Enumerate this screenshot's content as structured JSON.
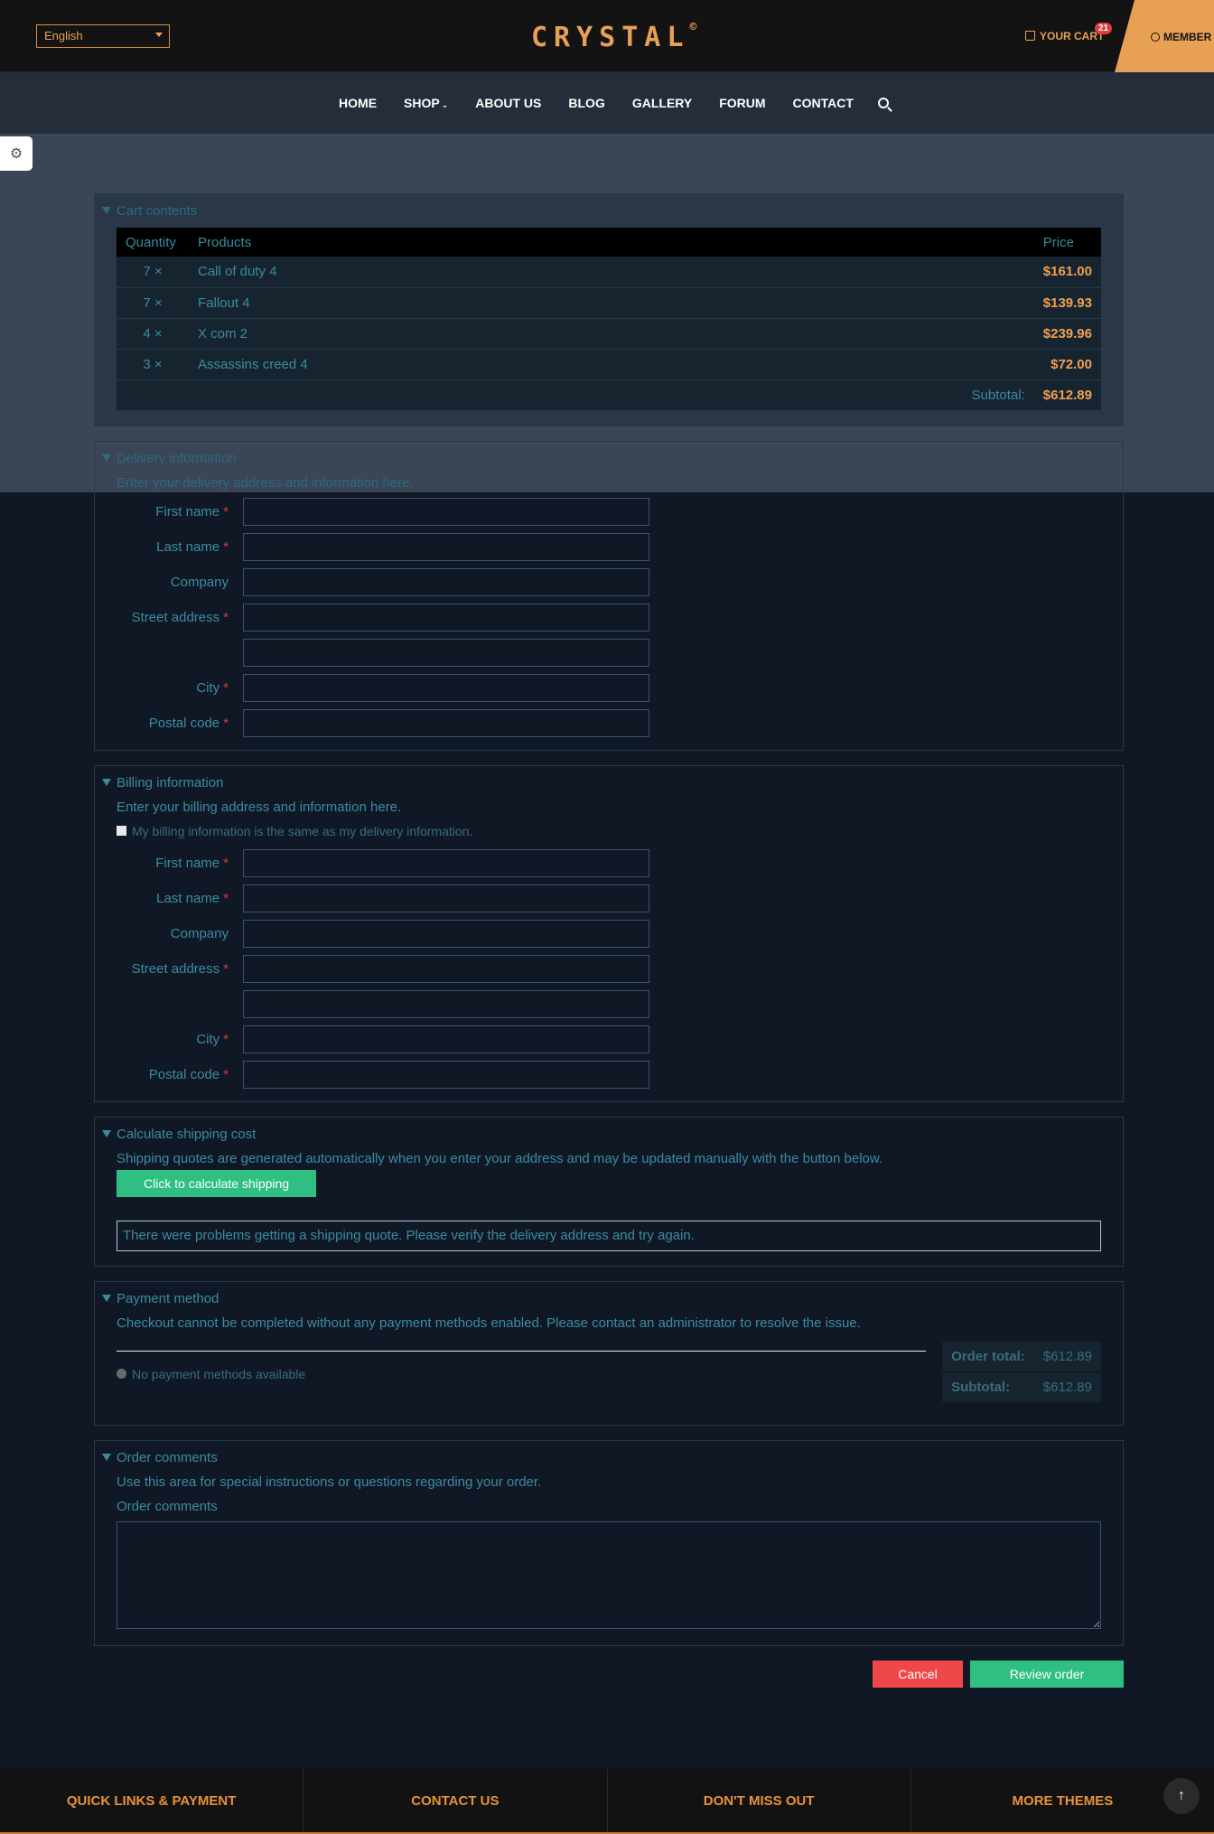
{
  "header": {
    "language": "English",
    "logo": "CRYSTAL",
    "logo_mark": "©",
    "cart_label": "YOUR CART",
    "cart_count": "21",
    "member_label": "MEMBER"
  },
  "nav": [
    "HOME",
    "SHOP",
    "ABOUT US",
    "BLOG",
    "GALLERY",
    "FORUM",
    "CONTACT"
  ],
  "cart": {
    "legend": "Cart contents",
    "headers": {
      "quantity": "Quantity",
      "products": "Products",
      "price": "Price"
    },
    "items": [
      {
        "qty": "7 ×",
        "name": "Call of duty 4",
        "price": "$161.00"
      },
      {
        "qty": "7 ×",
        "name": "Fallout 4",
        "price": "$139.93"
      },
      {
        "qty": "4 ×",
        "name": "X com 2",
        "price": "$239.96"
      },
      {
        "qty": "3 ×",
        "name": "Assassins creed 4",
        "price": "$72.00"
      }
    ],
    "subtotal_label": "Subtotal:",
    "subtotal": "$612.89"
  },
  "delivery": {
    "legend": "Delivery information",
    "hint": "Enter your delivery address and information here.",
    "fields": {
      "first": "First name",
      "last": "Last name",
      "company": "Company",
      "street": "Street address",
      "city": "City",
      "postal": "Postal code"
    },
    "required": "*"
  },
  "billing": {
    "legend": "Billing information",
    "hint": "Enter your billing address and information here.",
    "same_as_delivery": "My billing information is the same as my delivery information."
  },
  "shipping": {
    "legend": "Calculate shipping cost",
    "hint": "Shipping quotes are generated automatically when you enter your address and may be updated manually with the button below.",
    "button": "Click to calculate shipping",
    "error": "There were problems getting a shipping quote. Please verify the delivery address and try again."
  },
  "payment": {
    "legend": "Payment method",
    "hint": "Checkout cannot be completed without any payment methods enabled. Please contact an administrator to resolve the issue.",
    "none": "No payment methods available",
    "order_total_label": "Order total:",
    "order_total": "$612.89",
    "subtotal_label": "Subtotal:",
    "subtotal": "$612.89"
  },
  "comments": {
    "legend": "Order comments",
    "hint": "Use this area for special instructions or questions regarding your order.",
    "label": "Order comments"
  },
  "actions": {
    "cancel": "Cancel",
    "review": "Review order"
  },
  "footer": [
    "QUICK LINKS & PAYMENT",
    "CONTACT US",
    "DON'T MISS OUT",
    "MORE THEMES"
  ]
}
